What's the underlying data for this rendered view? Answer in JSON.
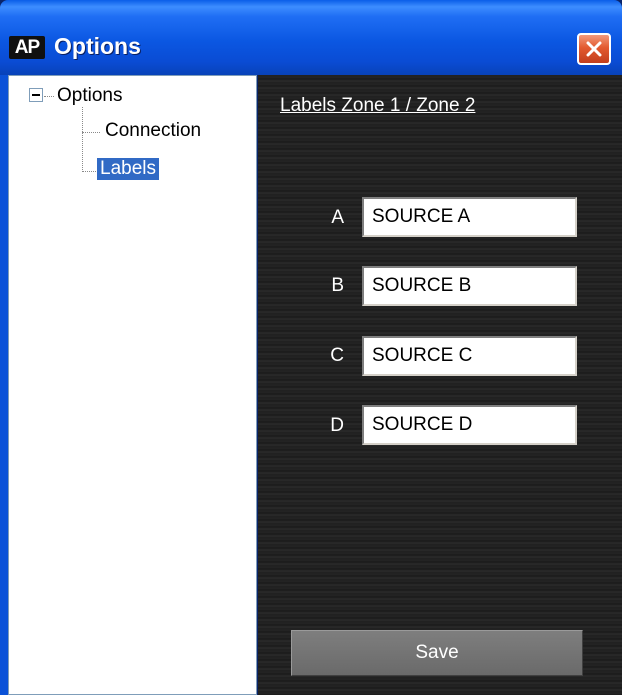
{
  "window": {
    "app_badge": "AP",
    "title": "Options"
  },
  "tree": {
    "root": "Options",
    "children": [
      "Connection",
      "Labels"
    ],
    "selected": "Labels"
  },
  "panel": {
    "title": "Labels Zone 1 / Zone 2",
    "rows": [
      {
        "label": "A",
        "value": "SOURCE A"
      },
      {
        "label": "B",
        "value": "SOURCE B"
      },
      {
        "label": "C",
        "value": "SOURCE C"
      },
      {
        "label": "D",
        "value": "SOURCE D"
      }
    ],
    "save_label": "Save"
  },
  "colors": {
    "titlebar": "#0b57e2",
    "selection": "#316ac5",
    "close_button": "#e35a2f",
    "panel_background": "#1f1f1f"
  }
}
